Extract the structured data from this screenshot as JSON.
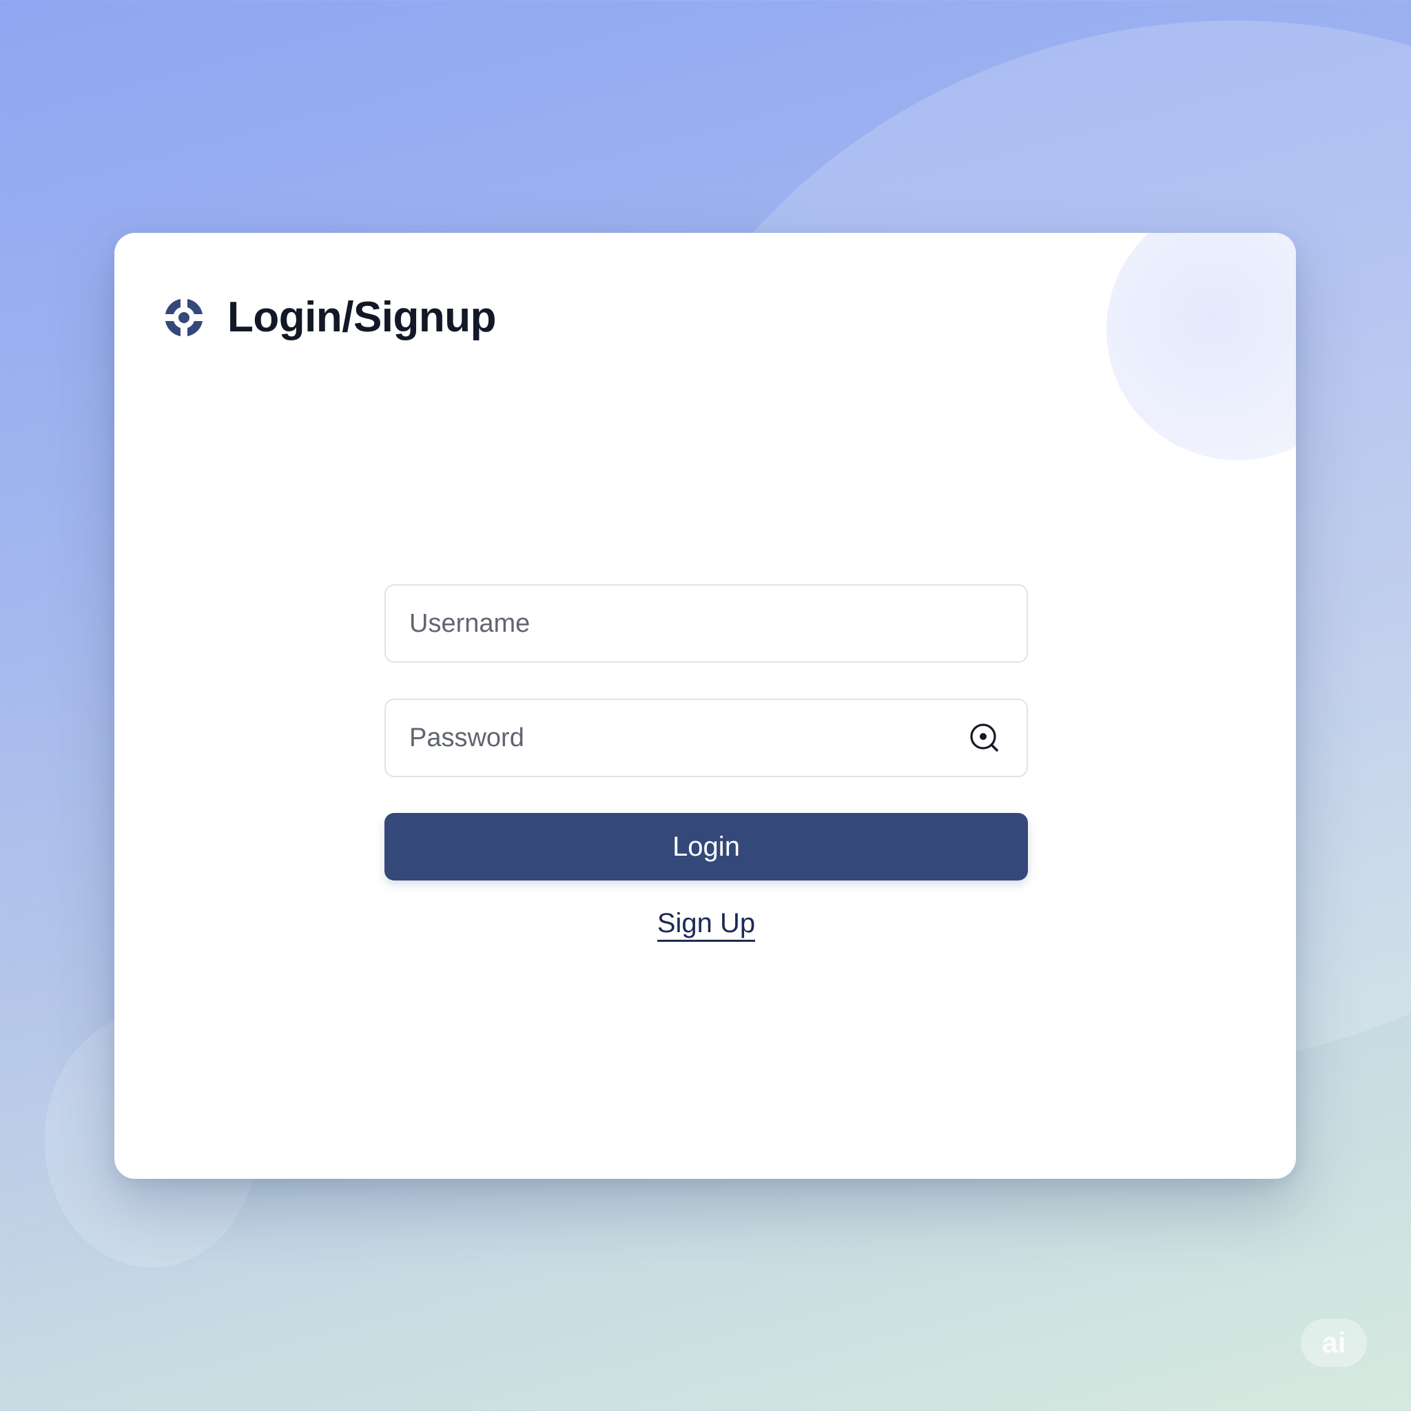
{
  "header": {
    "title": "Login/Signup",
    "logo_icon": "target-logo-icon"
  },
  "form": {
    "username": {
      "placeholder": "Username",
      "value": ""
    },
    "password": {
      "placeholder": "Password",
      "value": "",
      "reveal_icon": "password-reveal-icon"
    },
    "login_label": "Login",
    "signup_label": "Sign Up"
  },
  "watermark": {
    "text": "ai"
  },
  "colors": {
    "primary_button": "#34497a",
    "logo": "#34497a",
    "link": "#1d2a55",
    "title": "#121826"
  }
}
